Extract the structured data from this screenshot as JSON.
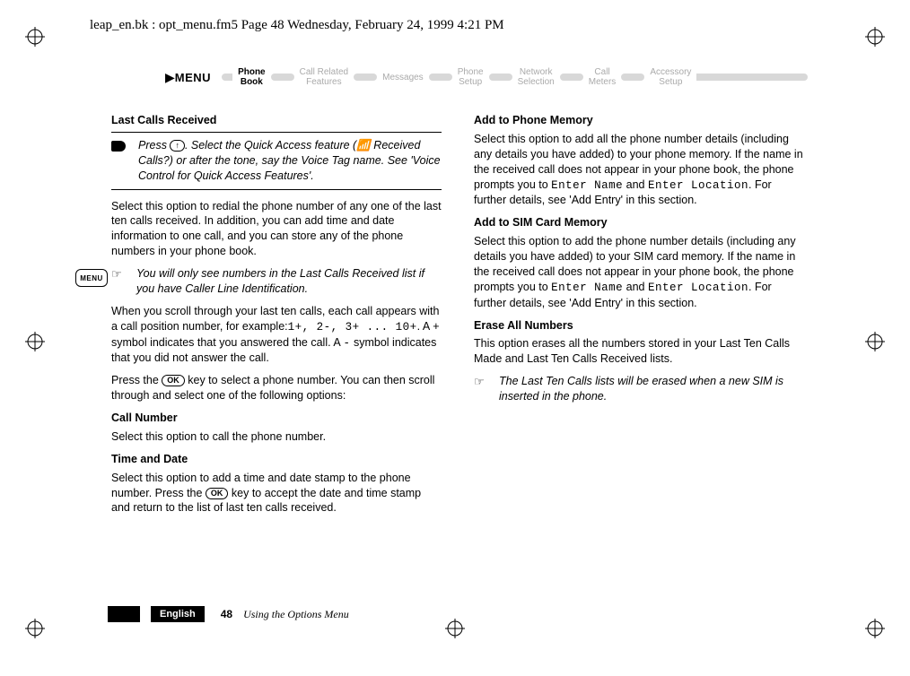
{
  "header": {
    "text": "leap_en.bk : opt_menu.fm5  Page 48  Wednesday, February 24, 1999  4:21 PM"
  },
  "menu": {
    "label": "MENU",
    "items": [
      {
        "line1": "Phone",
        "line2": "Book",
        "state": "active"
      },
      {
        "line1": "Call Related",
        "line2": "Features",
        "state": "inactive"
      },
      {
        "line1": "Messages",
        "line2": "",
        "state": "inactive"
      },
      {
        "line1": "Phone",
        "line2": "Setup",
        "state": "inactive"
      },
      {
        "line1": "Network",
        "line2": "Selection",
        "state": "inactive"
      },
      {
        "line1": "Call",
        "line2": "Meters",
        "state": "inactive"
      },
      {
        "line1": "Accessory",
        "line2": "Setup",
        "state": "inactive"
      }
    ]
  },
  "side_badge": "MENU",
  "left": {
    "h_last_calls": "Last Calls Received",
    "qa_icon": "arrow",
    "qa_pre": "Press ",
    "qa_key": "↑",
    "qa_mid": ". Select the Quick Access feature (",
    "qa_sig": "📶",
    "qa_tail": " Received Calls?) or after the tone, say the Voice Tag name. See 'Voice Control for Quick Access Features'.",
    "p1": "Select this option to redial the phone number of any one of the last ten calls received. In addition, you can add time and date information to one call, and you can store any of the phone numbers in your phone book.",
    "note1_icon": "☞",
    "note1": "You will only see numbers in the Last Calls Received list if you have Caller Line Identification.",
    "p2_pre": "When you scroll through your last ten calls, each call appears with a call position number, for example:",
    "p2_seq": "1+, 2-, 3+ ... 10+",
    "p2_mid": ". A ",
    "p2_plus": "+",
    "p2_mid2": " symbol indicates that you answered the call. A ",
    "p2_minus": "-",
    "p2_tail": " symbol indicates that you did not answer the call.",
    "p3_pre": "Press the ",
    "p3_key": "OK",
    "p3_tail": " key to select a phone number. You can then scroll through and select one of the following options:",
    "h_call_number": "Call Number",
    "p_call_number": "Select this option to call the phone number.",
    "h_time_date": "Time and Date",
    "p_td_pre": "Select this option to add a time and date stamp to the phone number. Press the ",
    "p_td_key": "OK",
    "p_td_tail": " key to accept the date and time stamp and return to the list of last ten calls received."
  },
  "right": {
    "h_add_phone": "Add to Phone Memory",
    "p_ap_pre": "Select this option to add all the phone number details (including any details you have added) to your phone memory. If the name in the received call does not appear in your phone book, the phone prompts you to ",
    "p_ap_m1": "Enter Name",
    "p_ap_and": " and ",
    "p_ap_m2": "Enter Location",
    "p_ap_tail": ". For further details, see 'Add Entry' in this section.",
    "h_add_sim": "Add to SIM Card Memory",
    "p_as_pre": "Select this option to add the phone number details (including any details you have added) to your SIM card memory. If the name in the received call does not appear in your phone book, the phone prompts you to ",
    "p_as_m1": "Enter Name",
    "p_as_and": " and ",
    "p_as_m2": "Enter Location",
    "p_as_tail": ". For further details, see 'Add Entry' in this section.",
    "h_erase": "Erase All Numbers",
    "p_erase": "This option erases all the numbers stored in your Last Ten Calls Made and Last Ten Calls Received lists.",
    "note2_icon": "☞",
    "note2": "The Last Ten Calls lists will be erased when a new SIM is inserted in the phone."
  },
  "footer": {
    "lang": "English",
    "page": "48",
    "section": "Using the Options Menu"
  }
}
